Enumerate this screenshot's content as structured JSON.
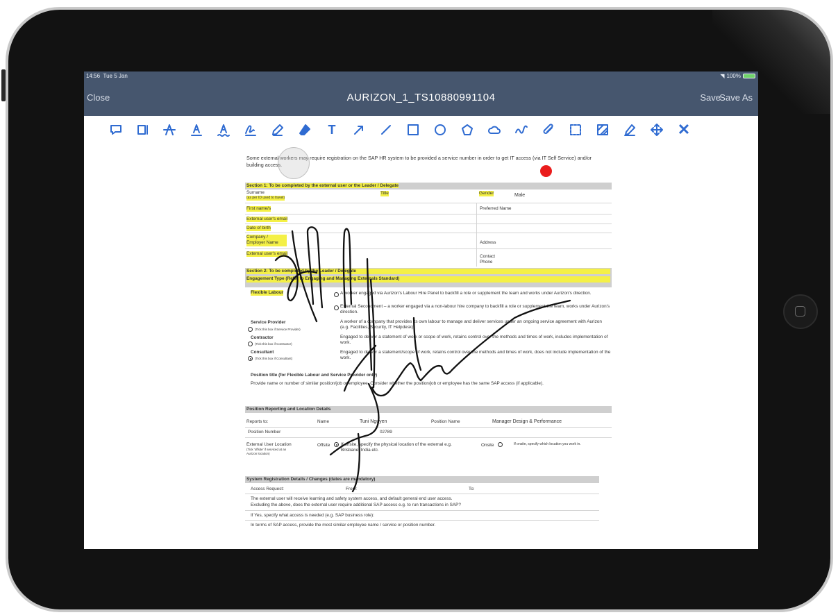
{
  "status": {
    "time": "14:56",
    "date": "Tue 5 Jan",
    "battery": "100%"
  },
  "nav": {
    "close": "Close",
    "title": "AURIZON_1_TS10880991104",
    "save": "Save",
    "save_as": "Save As"
  },
  "toolbar_icons": [
    "comment-icon",
    "note-icon",
    "strikethrough-icon",
    "underline-icon",
    "squiggly-icon",
    "signature-icon",
    "highlighter-icon",
    "eraser-icon",
    "text-icon",
    "arrow-icon",
    "line-icon",
    "rectangle-icon",
    "circle-icon",
    "pentagon-icon",
    "cloud-icon",
    "freehand-icon",
    "attachment-icon",
    "selection-icon",
    "redaction-icon",
    "pen-icon",
    "move-icon",
    "close-icon"
  ],
  "toolbar_glyphs": {
    "text": "T",
    "close": "✕"
  },
  "doc": {
    "intro": "Some external workers may require registration on the SAP HR system to be provided a service number in order to get IT access (via IT Self Service) and/or building access.",
    "section1": "Section 1: To be completed by the external user or the Leader / Delegate",
    "s1_rows": [
      "Surname",
      "First name/s",
      "External user's email",
      "Date of birth",
      "Company / Employer Name",
      "External user's email"
    ],
    "s1_sub": "(as per ID used to travel)",
    "title_label": "Title",
    "gender_label": "Gender",
    "gender_value": "Male",
    "preferred_name": "Preferred Name",
    "address": "Address",
    "contact_phone": "Contact Phone",
    "section2": "Section 2: To be completed by the Leader / Delegate",
    "engagement": "Engagement Type (Refer to Engaging and Managing Externals Standard)",
    "flexible_labour": "Flexible Labour",
    "bullets": [
      "A worker engaged via Aurizon's Labour Hire Panel to backfill a role or supplement the team and works under Aurizon's direction.",
      "External Secondment – a worker engaged via a non-labour hire company to backfill a role or supplement the team, works under Aurizon's direction.",
      "A worker of a company that provides its own labour to manage and deliver services under an ongoing service agreement with Aurizon (e.g. Facilities, Security, IT Helpdesk).",
      "Engaged to deliver a statement of work or scope of work, retains control over the methods and times of work, includes implementation of work.",
      "Engaged to deliver a statement/scope of work, retains control over the methods and times of work, does not include implementation of the work."
    ],
    "service_provider": "Service Provider",
    "contractor": "Contractor",
    "consultant": "Consultant",
    "tick_sp": "(Tick this box if Service Provider)",
    "tick_con": "(Tick this box if Contractor)",
    "tick_cons": "(Tick this box if Consultant)",
    "position_title_head": "Position title (for Flexible Labour and Service Provider only)",
    "position_title_text": "Provide name or number of similar position/job or employee. Consider whether the position/job or employee has the same SAP access (if applicable).",
    "position_reporting": "Position Reporting and Location Details",
    "reports_to": "Reports to:",
    "name_label": "Name",
    "name_value": "Tuni Nguyen",
    "position_name_label": "Position Name",
    "position_name_value": "Manager Design & Performance",
    "position_number_label": "Position Number",
    "position_number_value": "02789",
    "ext_location": "External User Location",
    "ext_location_sub": "(Tick 'offsite' if serviced at an Aurizon location)",
    "offsite": "Offsite",
    "offsite_text": "If offsite, specify the physical location of the external e.g. Brisbane, India etc.",
    "onsite": "Onsite",
    "onsite_text": "If onsite, specify which location you work in.",
    "sys_reg": "System Registration Details / Changes (dates are mandatory)",
    "access_request": "Access Request:",
    "from": "From:",
    "to": "To:",
    "sys_text1": "The external user will receive learning and safety system access, and default general end user access.",
    "sys_text2": "Excluding the above, does the external user require additional SAP access e.g. to run transactions in SAP?",
    "sys_text3": "If Yes, specify what access is needed (e.g. SAP business role):",
    "sys_text4": "In terms of SAP access, provide the most similar employee name / service or position number."
  }
}
